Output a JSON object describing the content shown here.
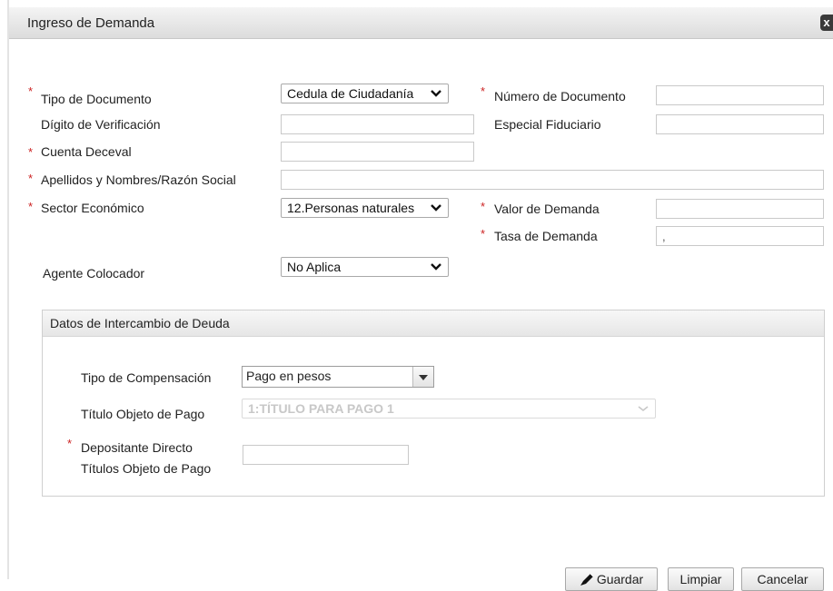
{
  "dialog": {
    "title": "Ingreso de Demanda",
    "close_glyph": "x"
  },
  "form": {
    "tipo_documento": {
      "label": "Tipo de Documento",
      "value": "Cedula de Ciudadanía"
    },
    "numero_documento": {
      "label": "Número de Documento",
      "value": ""
    },
    "digito_verificacion": {
      "label": "Dígito de Verificación",
      "value": ""
    },
    "especial_fiduciario": {
      "label": "Especial Fiduciario",
      "value": ""
    },
    "cuenta_deceval": {
      "label": "Cuenta Deceval",
      "value": ""
    },
    "apellidos_nombres": {
      "label": "Apellidos y Nombres/Razón Social",
      "value": ""
    },
    "sector_economico": {
      "label": "Sector Económico",
      "value": "12.Personas naturales"
    },
    "valor_demanda": {
      "label": "Valor de Demanda",
      "value": ""
    },
    "tasa_demanda": {
      "label": "Tasa de Demanda",
      "value": ","
    },
    "agente_colocador": {
      "label": "Agente Colocador",
      "value": "No Aplica"
    }
  },
  "section": {
    "title": "Datos de Intercambio de Deuda",
    "tipo_compensacion": {
      "label": "Tipo de Compensación",
      "value": "Pago en pesos"
    },
    "titulo_objeto_pago": {
      "label": "Título Objeto de Pago",
      "value": "1:TÍTULO PARA PAGO 1"
    },
    "depositante": {
      "label_line1": "Depositante Directo",
      "label_line2": "Títulos Objeto de Pago",
      "value": ""
    }
  },
  "actions": {
    "guardar": "Guardar",
    "limpiar": "Limpiar",
    "cancelar": "Cancelar"
  },
  "colors": {
    "required": "#cc2222",
    "disabled_text": "#c8c8c8"
  },
  "icons": {
    "close": "close-icon",
    "chevron": "chevron-down-icon",
    "pencil": "pencil-icon"
  }
}
